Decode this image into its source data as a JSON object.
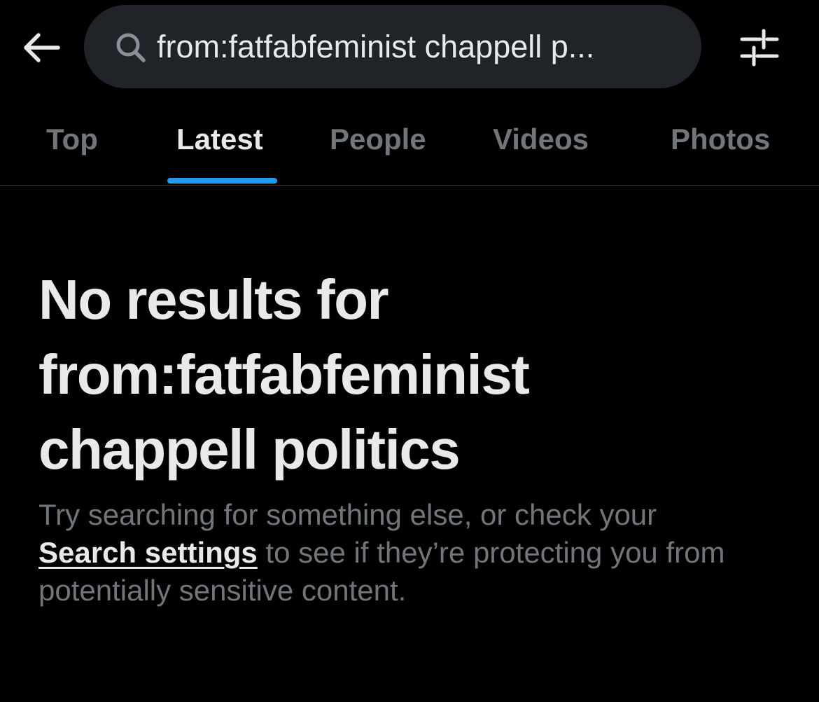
{
  "header": {
    "back_icon": "arrow-left-icon",
    "search": {
      "icon": "search-icon",
      "value": "from:fatfabfeminist chappell p..."
    },
    "filter_icon": "sliders-icon"
  },
  "tabs": [
    {
      "label": "Top",
      "active": false
    },
    {
      "label": "Latest",
      "active": true
    },
    {
      "label": "People",
      "active": false
    },
    {
      "label": "Videos",
      "active": false
    },
    {
      "label": "Photos",
      "active": false
    }
  ],
  "empty_state": {
    "title_lines": [
      "No results for",
      "from:fatfabfeminist",
      "chappell politics"
    ],
    "desc_line1": "Try searching for something else, or check your",
    "link_text": "Search settings",
    "desc_line2_rest": " to see if they’re protecting you from",
    "desc_line3": "potentially sensitive content."
  },
  "colors": {
    "background": "#000000",
    "search_bg": "#202327",
    "primary_text": "#e7e9ea",
    "secondary_text": "#71767b",
    "accent": "#1d9bf0",
    "divider": "#2f3336"
  }
}
